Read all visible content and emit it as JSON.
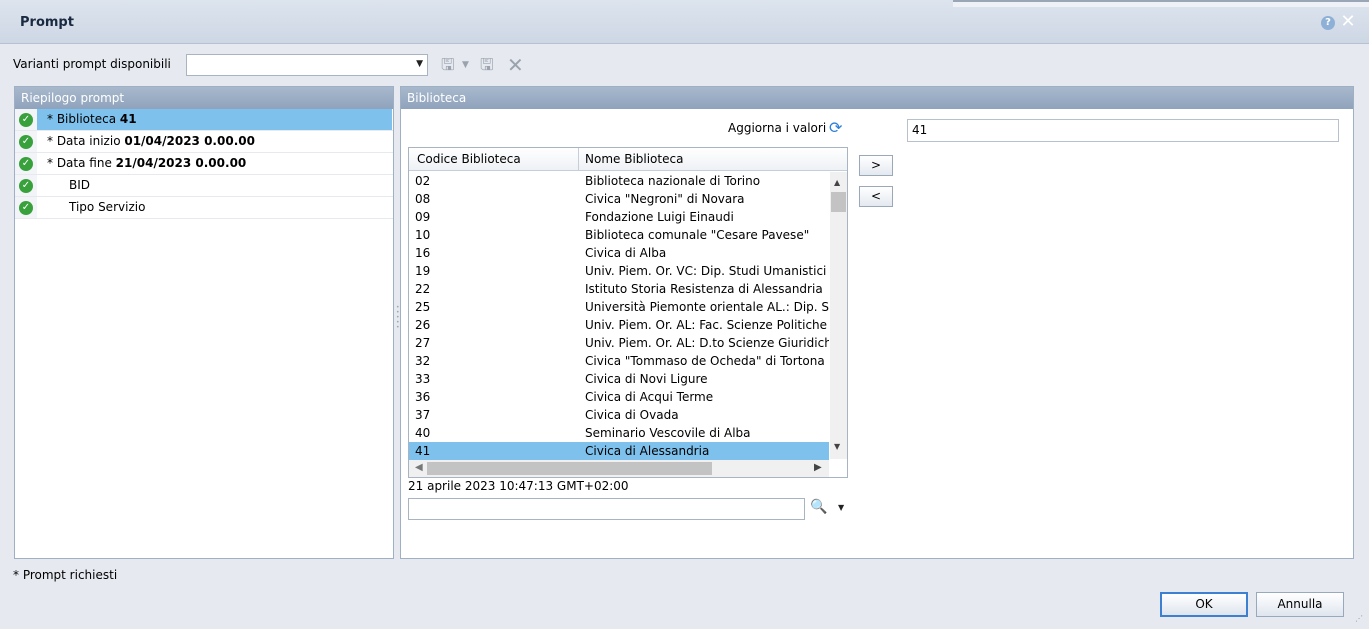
{
  "dialog": {
    "title": "Prompt",
    "help_icon": "?",
    "close_icon": "✕"
  },
  "variants": {
    "label": "Varianti prompt disponibili",
    "selected": ""
  },
  "toolbar_icons": [
    "save-icon",
    "save-dropdown-icon",
    "save-as-icon",
    "delete-icon"
  ],
  "summary": {
    "header": "Riepilogo prompt",
    "items": [
      {
        "label": "* Biblioteca ",
        "value": "41"
      },
      {
        "label": "* Data inizio ",
        "value": "01/04/2023 0.00.00"
      },
      {
        "label": "* Data fine ",
        "value": "21/04/2023 0.00.00"
      },
      {
        "label": "BID",
        "value": ""
      },
      {
        "label": "Tipo Servizio",
        "value": ""
      }
    ]
  },
  "biblioteca": {
    "header": "Biblioteca",
    "refresh_label": "Aggiorna i valori",
    "selected_value": "41",
    "columns": [
      "Codice Biblioteca",
      "Nome Biblioteca"
    ],
    "rows": [
      {
        "code": "02",
        "name": "Biblioteca nazionale di Torino"
      },
      {
        "code": "08",
        "name": "Civica \"Negroni\" di Novara"
      },
      {
        "code": "09",
        "name": "Fondazione Luigi Einaudi"
      },
      {
        "code": "10",
        "name": "Biblioteca comunale \"Cesare Pavese\""
      },
      {
        "code": "16",
        "name": "Civica di Alba"
      },
      {
        "code": "19",
        "name": "Univ. Piem. Or. VC: Dip. Studi Umanistici"
      },
      {
        "code": "22",
        "name": "Istituto Storia Resistenza di Alessandria"
      },
      {
        "code": "25",
        "name": "Università Piemonte orientale AL.: Dip. Sc"
      },
      {
        "code": "26",
        "name": "Univ. Piem. Or. AL: Fac. Scienze Politiche ("
      },
      {
        "code": "27",
        "name": "Univ. Piem. Or. AL: D.to Scienze Giuridiche"
      },
      {
        "code": "32",
        "name": "Civica \"Tommaso de Ocheda\" di Tortona"
      },
      {
        "code": "33",
        "name": "Civica di Novi Ligure"
      },
      {
        "code": "36",
        "name": "Civica di Acqui Terme"
      },
      {
        "code": "37",
        "name": "Civica di Ovada"
      },
      {
        "code": "40",
        "name": "Seminario Vescovile di Alba"
      },
      {
        "code": "41",
        "name": "Civica di Alessandria"
      }
    ],
    "timestamp": "21 aprile 2023 10:47:13 GMT+02:00",
    "search_value": "",
    "move_right_label": ">",
    "move_left_label": "<"
  },
  "footer": {
    "required_note": "* Prompt richiesti",
    "ok_label": "OK",
    "cancel_label": "Annulla"
  }
}
